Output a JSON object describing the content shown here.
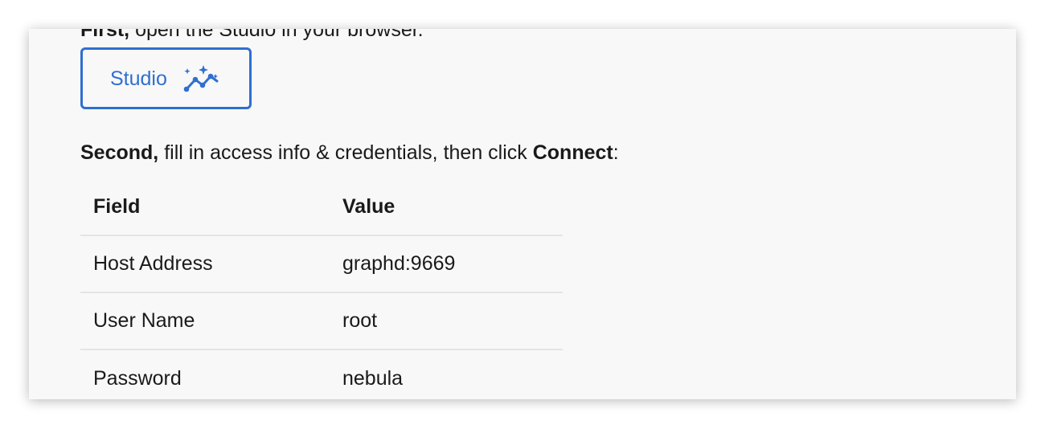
{
  "step1": {
    "lead": "First,",
    "text": " open the Studio in your browser."
  },
  "studio_button": {
    "label": "Studio",
    "icon": "sparkle-chart-icon",
    "color": "#2f6fd0"
  },
  "step2": {
    "lead": "Second,",
    "text": " fill in access info & credentials, then click ",
    "action": "Connect",
    "suffix": ":"
  },
  "table": {
    "headers": [
      "Field",
      "Value"
    ],
    "rows": [
      [
        "Host Address",
        "graphd:9669"
      ],
      [
        "User Name",
        "root"
      ],
      [
        "Password",
        "nebula"
      ]
    ]
  }
}
